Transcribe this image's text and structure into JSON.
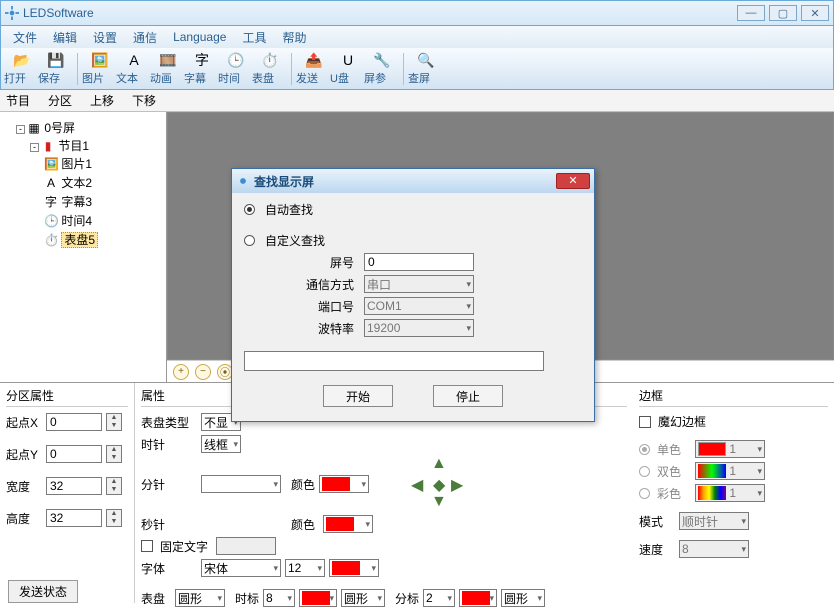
{
  "app": {
    "title": "LEDSoftware"
  },
  "menu": [
    "文件",
    "编辑",
    "设置",
    "通信",
    "Language",
    "工具",
    "帮助"
  ],
  "toolbar": [
    {
      "icon": "📂",
      "label": "打开"
    },
    {
      "icon": "💾",
      "label": "保存"
    },
    {
      "sep": true
    },
    {
      "icon": "🖼️",
      "label": "图片"
    },
    {
      "icon": "A",
      "label": "文本"
    },
    {
      "icon": "🎞️",
      "label": "动画"
    },
    {
      "icon": "字",
      "label": "字幕"
    },
    {
      "icon": "🕒",
      "label": "时间"
    },
    {
      "icon": "⏱️",
      "label": "表盘"
    },
    {
      "sep": true
    },
    {
      "icon": "📤",
      "label": "发送"
    },
    {
      "icon": "U",
      "label": "U盘"
    },
    {
      "icon": "🔧",
      "label": "屏参"
    },
    {
      "sep": true
    },
    {
      "icon": "🔍",
      "label": "查屏"
    }
  ],
  "subtoolbar": [
    "节目",
    "分区",
    "上移",
    "下移"
  ],
  "tree": {
    "root": "0号屏",
    "program": "节目1",
    "items": [
      {
        "icon": "🖼️",
        "label": "图片1"
      },
      {
        "icon": "A",
        "label": "文本2"
      },
      {
        "icon": "字",
        "label": "字幕3"
      },
      {
        "icon": "🕒",
        "label": "时间4"
      },
      {
        "icon": "⏱️",
        "label": "表盘5",
        "selected": true
      }
    ]
  },
  "zone": {
    "title": "分区属性",
    "startX": {
      "label": "起点X",
      "value": "0"
    },
    "startY": {
      "label": "起点Y",
      "value": "0"
    },
    "width": {
      "label": "宽度",
      "value": "32"
    },
    "height": {
      "label": "高度",
      "value": "32"
    }
  },
  "props": {
    "title": "属性",
    "dialType": {
      "label": "表盘类型",
      "value": "不显"
    },
    "hourHand": {
      "label": "时针",
      "value": "线框"
    },
    "minuteHand": {
      "label": "分针",
      "colorLabel": "颜色"
    },
    "secondHand": {
      "label": "秒针",
      "colorLabel": "颜色"
    },
    "fixedText": {
      "label": "固定文字"
    },
    "font": {
      "label": "字体",
      "value": "宋体",
      "size": "12"
    },
    "dial": {
      "label": "表盘",
      "shape": "圆形",
      "markLabel": "时标",
      "mark": "8",
      "markShape": "圆形",
      "minLabel": "分标",
      "min": "2",
      "minShape": "圆形"
    }
  },
  "border": {
    "title": "边框",
    "magic": "魔幻边框",
    "single": {
      "label": "单色",
      "value": "1"
    },
    "double": {
      "label": "双色",
      "value": "1"
    },
    "color": {
      "label": "彩色",
      "value": "1"
    },
    "mode": {
      "label": "模式",
      "value": "顺时针"
    },
    "speed": {
      "label": "速度",
      "value": "8"
    }
  },
  "dialog": {
    "title": "查找显示屏",
    "auto": "自动查找",
    "custom": "自定义查找",
    "screenNo": {
      "label": "屏号",
      "value": "0"
    },
    "comm": {
      "label": "通信方式",
      "value": "串口"
    },
    "port": {
      "label": "端口号",
      "value": "COM1"
    },
    "baud": {
      "label": "波特率",
      "value": "19200"
    },
    "start": "开始",
    "stop": "停止"
  },
  "statusBtn": "发送状态"
}
